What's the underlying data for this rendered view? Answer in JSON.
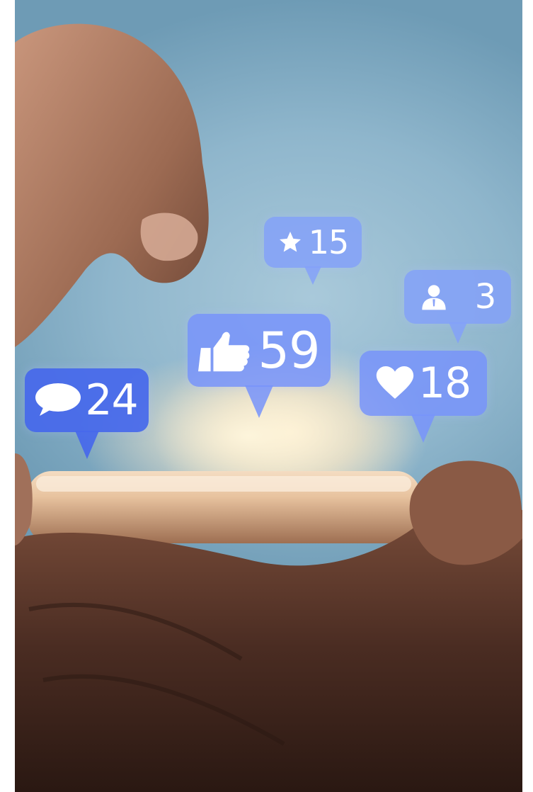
{
  "notifications": {
    "star": {
      "icon": "star-icon",
      "count": "15"
    },
    "follower": {
      "icon": "user-icon",
      "count": "3"
    },
    "like": {
      "icon": "thumbs-up-icon",
      "count": "59"
    },
    "heart": {
      "icon": "heart-icon",
      "count": "18"
    },
    "comment": {
      "icon": "speech-bubble-icon",
      "count": "24"
    }
  },
  "colors": {
    "bubble": "#6886f6",
    "bubble_dark": "#4668eb",
    "background": "#8fb6cc",
    "skin": "#b07a5e",
    "phone": "#d8b48e"
  }
}
